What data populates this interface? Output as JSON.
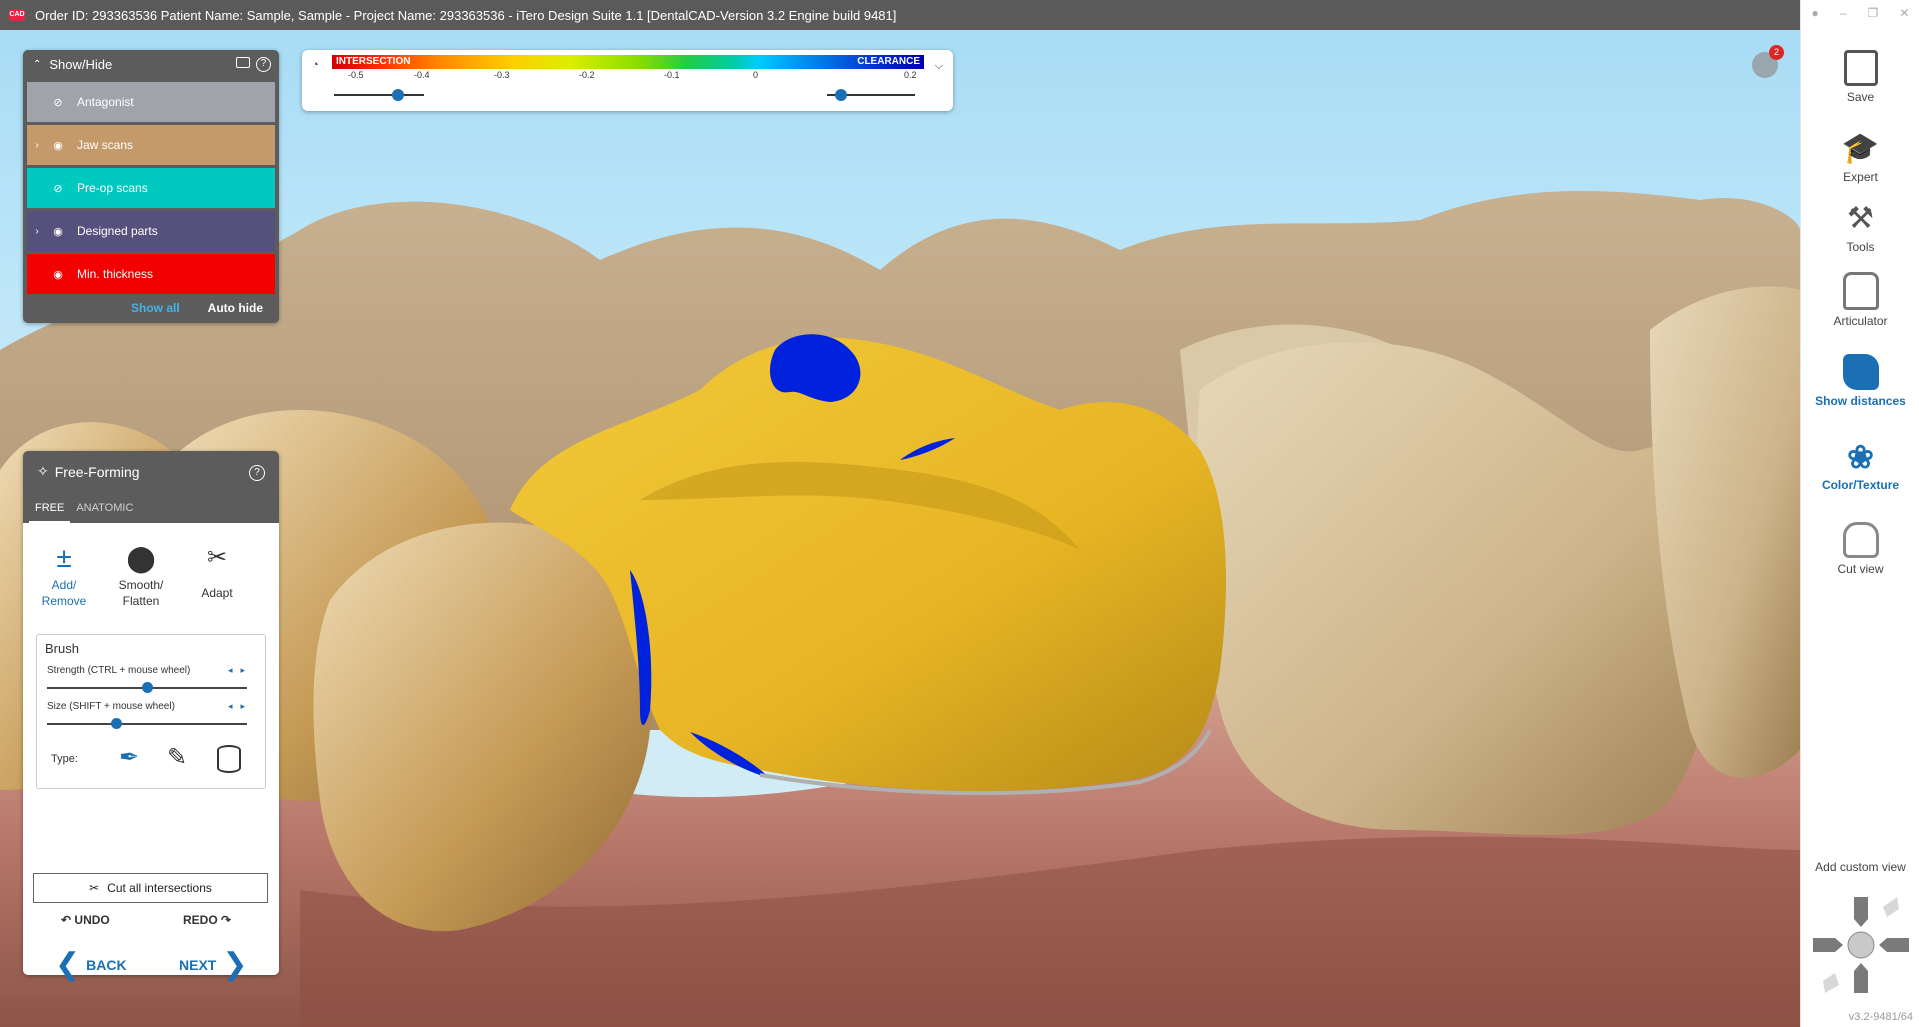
{
  "window": {
    "title": "Order ID: 293363536 Patient Name: Sample, Sample - Project Name: 293363536 - iTero Design Suite 1.1 [DentalCAD-Version 3.2 Engine build 9481]",
    "app_icon_text": "CAD"
  },
  "show_hide": {
    "title": "Show/Hide",
    "items": [
      {
        "label": "Antagonist",
        "color": "#a0a3aa",
        "expandable": false,
        "visible": false
      },
      {
        "label": "Jaw scans",
        "color": "#c59a6a",
        "expandable": true,
        "visible": true
      },
      {
        "label": "Pre-op scans",
        "color": "#00c9c0",
        "expandable": false,
        "visible": false
      },
      {
        "label": "Designed parts",
        "color": "#56517c",
        "expandable": true,
        "visible": true
      },
      {
        "label": "Min. thickness",
        "color": "#f30000",
        "expandable": false,
        "visible": true
      }
    ],
    "show_all": "Show all",
    "auto_hide": "Auto hide"
  },
  "distance_scale": {
    "intersection_label": "INTERSECTION",
    "clearance_label": "CLEARANCE",
    "ticks": [
      "-0.5",
      "-0.4",
      "-0.3",
      "-0.2",
      "-0.1",
      "0",
      "0.2"
    ]
  },
  "notifications": {
    "count": "2"
  },
  "free_forming": {
    "title": "Free-Forming",
    "tabs": [
      "FREE",
      "ANATOMIC"
    ],
    "tools": [
      {
        "label_1": "Add/",
        "label_2": "Remove"
      },
      {
        "label_1": "Smooth/",
        "label_2": "Flatten"
      },
      {
        "label_1": "Adapt",
        "label_2": ""
      }
    ],
    "brush": {
      "title": "Brush",
      "strength_label": "Strength (CTRL + mouse wheel)",
      "strength_value": 0.47,
      "size_label": "Size (SHIFT + mouse wheel)",
      "size_value": 0.34,
      "type_label": "Type:"
    },
    "cut_all": "Cut all intersections",
    "undo": "UNDO",
    "redo": "REDO",
    "back": "BACK",
    "next": "NEXT"
  },
  "sidebar": {
    "items": [
      {
        "label": "Save",
        "icon": "save-icon"
      },
      {
        "label": "Expert",
        "icon": "graduation-cap-icon"
      },
      {
        "label": "Tools",
        "icon": "tools-icon"
      },
      {
        "label": "Articulator",
        "icon": "articulator-icon"
      },
      {
        "label": "Show distances",
        "icon": "show-distances-icon"
      },
      {
        "label": "Color/Texture",
        "icon": "palette-icon"
      },
      {
        "label": "Cut view",
        "icon": "cut-view-icon"
      }
    ],
    "add_custom_view": "Add custom view",
    "version": "v3.2-9481/64"
  },
  "colors": {
    "accent": "#1a6fb5",
    "panel": "#5c5c5c",
    "crown": "#ebbc2d",
    "intersection_blue": "#0022dd"
  }
}
